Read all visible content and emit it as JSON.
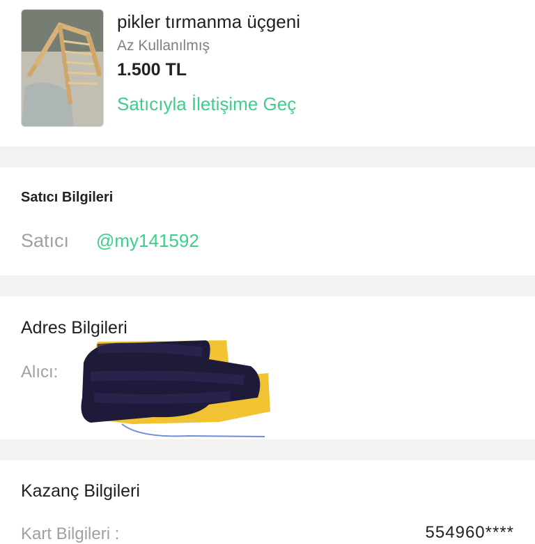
{
  "product": {
    "title": "pikler tırmanma üçgeni",
    "condition": "Az Kullanılmış",
    "price": "1.500 TL",
    "contact_label": "Satıcıyla İletişime Geç"
  },
  "seller_section": {
    "title": "Satıcı Bilgileri",
    "seller_label": "Satıcı",
    "seller_handle": "@my141592"
  },
  "address_section": {
    "title": "Adres Bilgileri",
    "recipient_label": "Alıcı:"
  },
  "earnings_section": {
    "title": "Kazanç Bilgileri",
    "card_label": "Kart Bilgileri :",
    "card_value": "554960****"
  },
  "colors": {
    "accent": "#3ccf8a",
    "divider": "#f2f2f2",
    "muted_text": "#a0a0a0"
  }
}
